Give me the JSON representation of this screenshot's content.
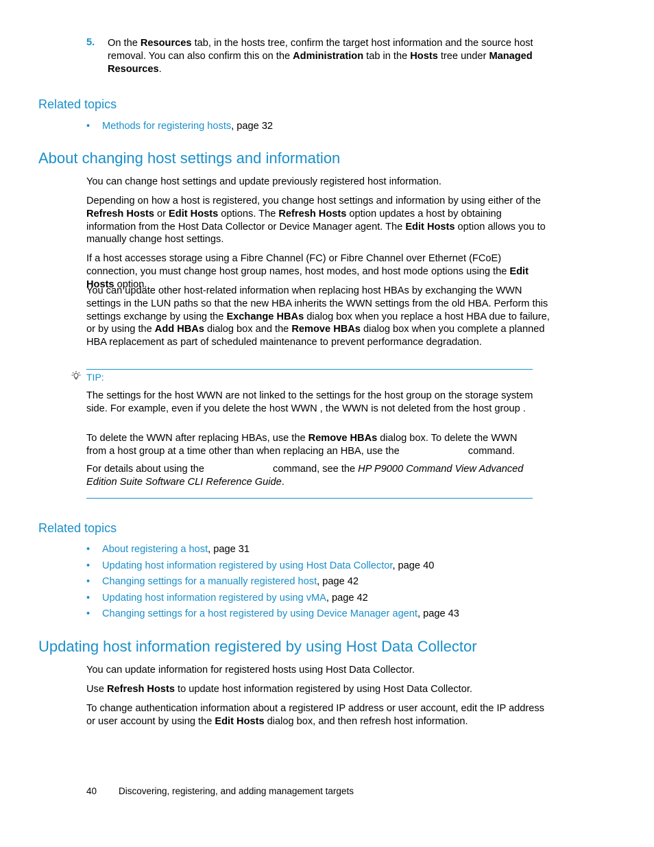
{
  "step5": {
    "number": "5.",
    "text_parts": [
      "On the ",
      "Resources",
      " tab, in the hosts tree, confirm the target host information and the source host removal. You can also confirm this on the ",
      "Administration",
      " tab in the ",
      "Hosts",
      " tree under ",
      "Managed Resources",
      "."
    ]
  },
  "related1": {
    "heading": "Related topics",
    "items": [
      {
        "link": "Methods for registering hosts",
        "suffix": ", page 32"
      }
    ]
  },
  "section1": {
    "title": "About changing host settings and information",
    "p1": "You can change host settings and update previously registered host information.",
    "p2": [
      "Depending on how a host is registered, you change host settings and information by using either of the ",
      "Refresh Hosts",
      " or ",
      "Edit Hosts",
      " options. The ",
      "Refresh Hosts",
      " option updates a host by obtaining information from the Host Data Collector or Device Manager agent. The ",
      "Edit Hosts",
      " option allows you to manually change host settings."
    ],
    "p3": [
      "If a host accesses storage using a Fibre Channel (FC) or Fibre Channel over Ethernet (FCoE) connection, you must change host group names, host modes, and host mode options using the ",
      "Edit Hosts",
      " option."
    ],
    "p4": [
      "You can update other host-related information when replacing host HBAs by exchanging the WWN settings in the LUN paths so that the new HBA inherits the WWN settings from the old HBA. Perform this settings exchange by using the ",
      "Exchange HBAs",
      " dialog box when you replace a host HBA due to failure, or by using the ",
      "Add HBAs",
      " dialog box and the ",
      "Remove HBAs",
      " dialog box when you complete a planned HBA replacement as part of scheduled maintenance to prevent performance degradation."
    ]
  },
  "tip": {
    "label": "TIP:",
    "icon": "lightbulb-icon",
    "p1": "The settings for the host WWN are not linked to the settings for the host group on the storage system side. For example, even if you delete the host WWN , the WWN is not deleted from the host group .",
    "p2": [
      "To delete the WWN after replacing HBAs, use the ",
      "Remove HBAs",
      " dialog box. To delete the WWN from a host group at a time other than when replacing an HBA, use the ",
      "command."
    ],
    "p3": [
      "For details about using the ",
      "command, see the ",
      "HP P9000 Command View Advanced Edition Suite Software CLI Reference Guide",
      "."
    ]
  },
  "related2": {
    "heading": "Related topics",
    "items": [
      {
        "link": "About registering a host",
        "suffix": ", page 31"
      },
      {
        "link": "Updating host information registered by using Host Data Collector",
        "suffix": ", page 40"
      },
      {
        "link": "Changing settings for a manually registered host",
        "suffix": ", page 42"
      },
      {
        "link": "Updating host information registered by using vMA",
        "suffix": ", page 42"
      },
      {
        "link": "Changing settings for a host registered by using Device Manager agent",
        "suffix": ", page 43"
      }
    ]
  },
  "section2": {
    "title": "Updating host information registered by using Host Data Collector",
    "p1": "You can update information for registered hosts using Host Data Collector.",
    "p2": [
      "Use ",
      "Refresh Hosts",
      " to update host information registered by using Host Data Collector."
    ],
    "p3": [
      "To change authentication information about a registered IP address or user account, edit the IP address or user account by using the ",
      "Edit Hosts",
      " dialog box, and then refresh host information."
    ]
  },
  "footer": {
    "page_number": "40",
    "chapter": "Discovering, registering, and adding management targets"
  },
  "colors": {
    "accent": "#1a8fc9",
    "text": "#000000"
  }
}
